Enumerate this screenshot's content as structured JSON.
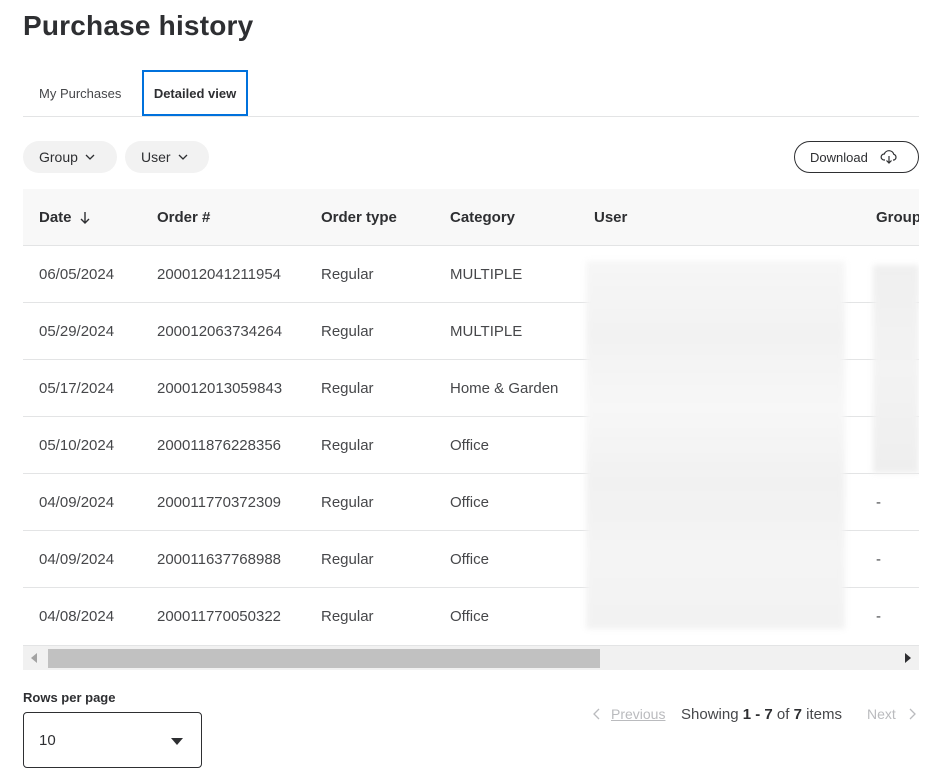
{
  "page": {
    "title": "Purchase history"
  },
  "tabs": [
    {
      "label": "My Purchases",
      "active": false
    },
    {
      "label": "Detailed view",
      "active": true
    }
  ],
  "filters": {
    "group_label": "Group",
    "user_label": "User"
  },
  "download": {
    "label": "Download"
  },
  "table": {
    "columns": [
      "Date",
      "Order #",
      "Order type",
      "Category",
      "User",
      "Group"
    ],
    "sort": {
      "column": "Date",
      "direction": "desc"
    },
    "rows": [
      {
        "date": "06/05/2024",
        "order": "200012041211954",
        "type": "Regular",
        "category": "MULTIPLE",
        "user": "",
        "group": ""
      },
      {
        "date": "05/29/2024",
        "order": "200012063734264",
        "type": "Regular",
        "category": "MULTIPLE",
        "user": "",
        "group": ""
      },
      {
        "date": "05/17/2024",
        "order": "200012013059843",
        "type": "Regular",
        "category": "Home & Garden",
        "user": "",
        "group": ""
      },
      {
        "date": "05/10/2024",
        "order": "200011876228356",
        "type": "Regular",
        "category": "Office",
        "user": "",
        "group": ""
      },
      {
        "date": "04/09/2024",
        "order": "200011770372309",
        "type": "Regular",
        "category": "Office",
        "user": "",
        "group": "-"
      },
      {
        "date": "04/09/2024",
        "order": "200011637768988",
        "type": "Regular",
        "category": "Office",
        "user": "",
        "group": "-"
      },
      {
        "date": "04/08/2024",
        "order": "200011770050322",
        "type": "Regular",
        "category": "Office",
        "user": "",
        "group": "-"
      }
    ]
  },
  "pagination": {
    "rows_per_page_label": "Rows per page",
    "rows_per_page_value": "10",
    "previous_label": "Previous",
    "next_label": "Next",
    "showing_prefix": "Showing",
    "range": "1 - 7",
    "of_label": "of",
    "total": "7",
    "items_label": "items"
  },
  "colors": {
    "accent": "#0071dc",
    "text": "#2e2f32",
    "disabled": "#babbbe",
    "header_bg": "#f8f8f8"
  }
}
